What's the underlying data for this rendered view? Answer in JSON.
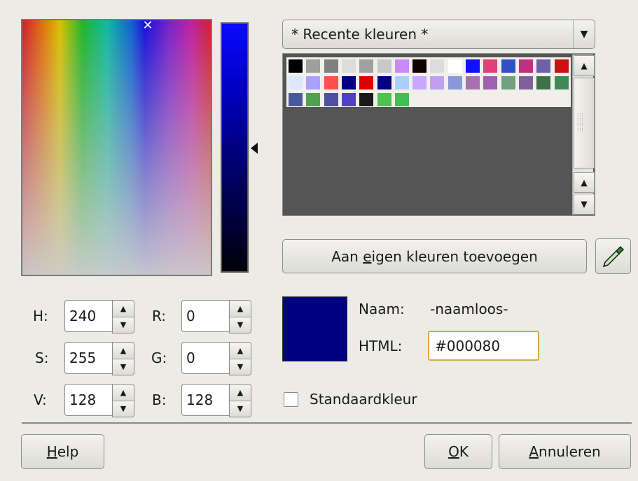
{
  "palette": {
    "dropdown_label": "* Recente kleuren *",
    "swatches": [
      "#000000",
      "#9e9e9e",
      "#808080",
      "#dcdcdc",
      "#a0a0a0",
      "#c8c8c8",
      "#cc88ff",
      "#100000",
      "#dcdcdc",
      "#ffffff",
      "#1010ff",
      "#e0407a",
      "#3050c8",
      "#c03080",
      "#7060a8",
      "#cc1010",
      "#dde8ff",
      "#aaa0ff",
      "#ff5050",
      "#000080",
      "#e00000",
      "#000080",
      "#a8d0ff",
      "#c8a8ff",
      "#c0a0f0",
      "#8898d8",
      "#a870b0",
      "#a060b0",
      "#70a080",
      "#806098",
      "#407048",
      "#408858",
      "#4a5a98",
      "#50a050",
      "#5050a0",
      "#5040c8",
      "#1a1a1a",
      "#50c050",
      "#40c050"
    ]
  },
  "add_button": {
    "pre": "Aan ",
    "accel": "e",
    "post": "igen kleuren toevoegen"
  },
  "fields": {
    "h": {
      "label": "H:",
      "value": "240"
    },
    "s": {
      "label": "S:",
      "value": "255"
    },
    "v": {
      "label": "V:",
      "value": "128"
    },
    "r": {
      "label": "R:",
      "value": "0"
    },
    "g": {
      "label": "G:",
      "value": "0"
    },
    "b": {
      "label": "B:",
      "value": "128"
    }
  },
  "name": {
    "label": "Naam:",
    "value": "-naamloos-"
  },
  "html": {
    "label": "HTML:",
    "value": "#000080"
  },
  "preview_color": "#000080",
  "standard_color": {
    "label": "Standaardkleur",
    "checked": false
  },
  "buttons": {
    "help": {
      "accel": "H",
      "rest": "elp"
    },
    "ok": {
      "accel": "O",
      "rest": "K"
    },
    "cancel": {
      "accel": "A",
      "rest": "nnuleren"
    }
  }
}
